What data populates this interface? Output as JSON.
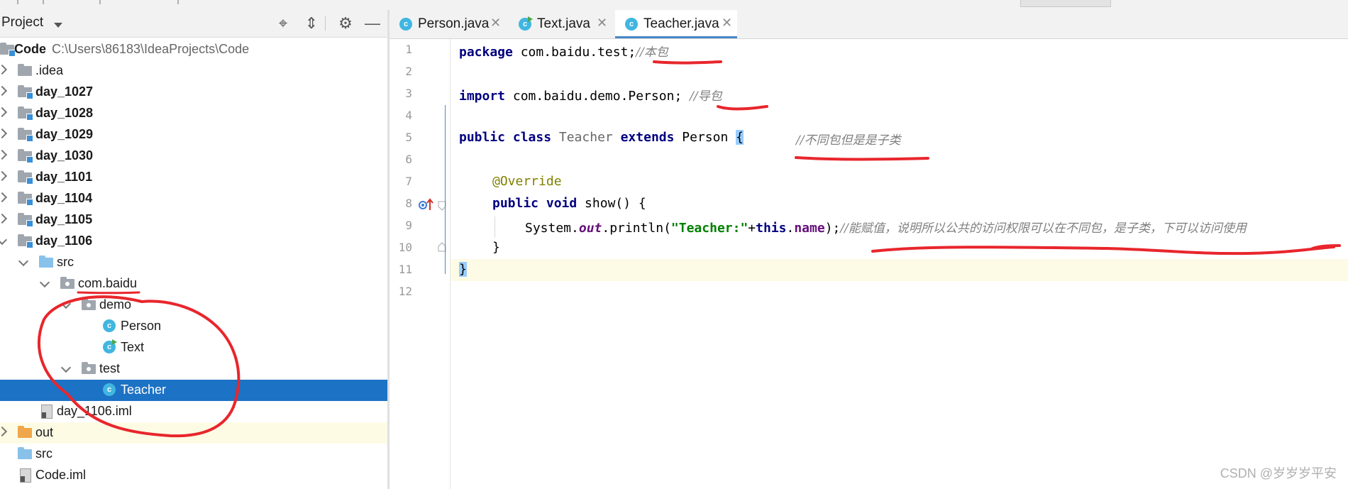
{
  "project_panel": {
    "title": "Project",
    "tree": [
      {
        "label": "Code",
        "path": "C:\\Users\\86183\\IdeaProjects\\Code"
      },
      {
        "label": ".idea"
      },
      {
        "label": "day_1027"
      },
      {
        "label": "day_1028"
      },
      {
        "label": "day_1029"
      },
      {
        "label": "day_1030"
      },
      {
        "label": "day_1101"
      },
      {
        "label": "day_1104"
      },
      {
        "label": "day_1105"
      },
      {
        "label": "day_1106"
      },
      {
        "label": "src"
      },
      {
        "label": "com.baidu"
      },
      {
        "label": "demo"
      },
      {
        "label": "Person"
      },
      {
        "label": "Text"
      },
      {
        "label": "test"
      },
      {
        "label": "Teacher"
      },
      {
        "label": "day_1106.iml"
      },
      {
        "label": "out"
      },
      {
        "label": "src"
      },
      {
        "label": "Code.iml"
      }
    ]
  },
  "editor": {
    "tabs": [
      {
        "label": "Person.java"
      },
      {
        "label": "Text.java"
      },
      {
        "label": "Teacher.java"
      }
    ],
    "active_tab": "Teacher.java",
    "line_numbers": [
      "1",
      "2",
      "3",
      "4",
      "5",
      "6",
      "7",
      "8",
      "9",
      "10",
      "11",
      "12"
    ],
    "code": {
      "l1_kw": "package",
      "l1_rest": " com.baidu.test;",
      "l1_cmt": "//本包",
      "l3_kw": "import",
      "l3_rest": " com.baidu.demo.Person; ",
      "l3_cmt": "//导包",
      "l5_kw1": "public class",
      "l5_cls": " Teacher ",
      "l5_kw2": "extends",
      "l5_rest": " Person ",
      "l5_brace": "{",
      "l5_cmt": "//不同包但是是子类",
      "l7_ann": "@Override",
      "l8_kw": "public void",
      "l8_rest": " show() {",
      "l9_a": "System.",
      "l9_out": "out",
      "l9_b": ".println(",
      "l9_str": "\"Teacher:\"",
      "l9_c": "+",
      "l9_this": "this",
      "l9_d": ".",
      "l9_name": "name",
      "l9_e": ");",
      "l9_cmt": "//能赋值，说明所以公共的访问权限可以在不同包，是子类，下可以访问使用",
      "l10": "}",
      "l11": "}"
    }
  },
  "watermark": "CSDN @岁岁岁平安",
  "colors": {
    "selection": "#1c72c4",
    "keyword": "#000080",
    "string": "#008000",
    "comment": "#808080",
    "annotation_pen": "#e8262c"
  }
}
